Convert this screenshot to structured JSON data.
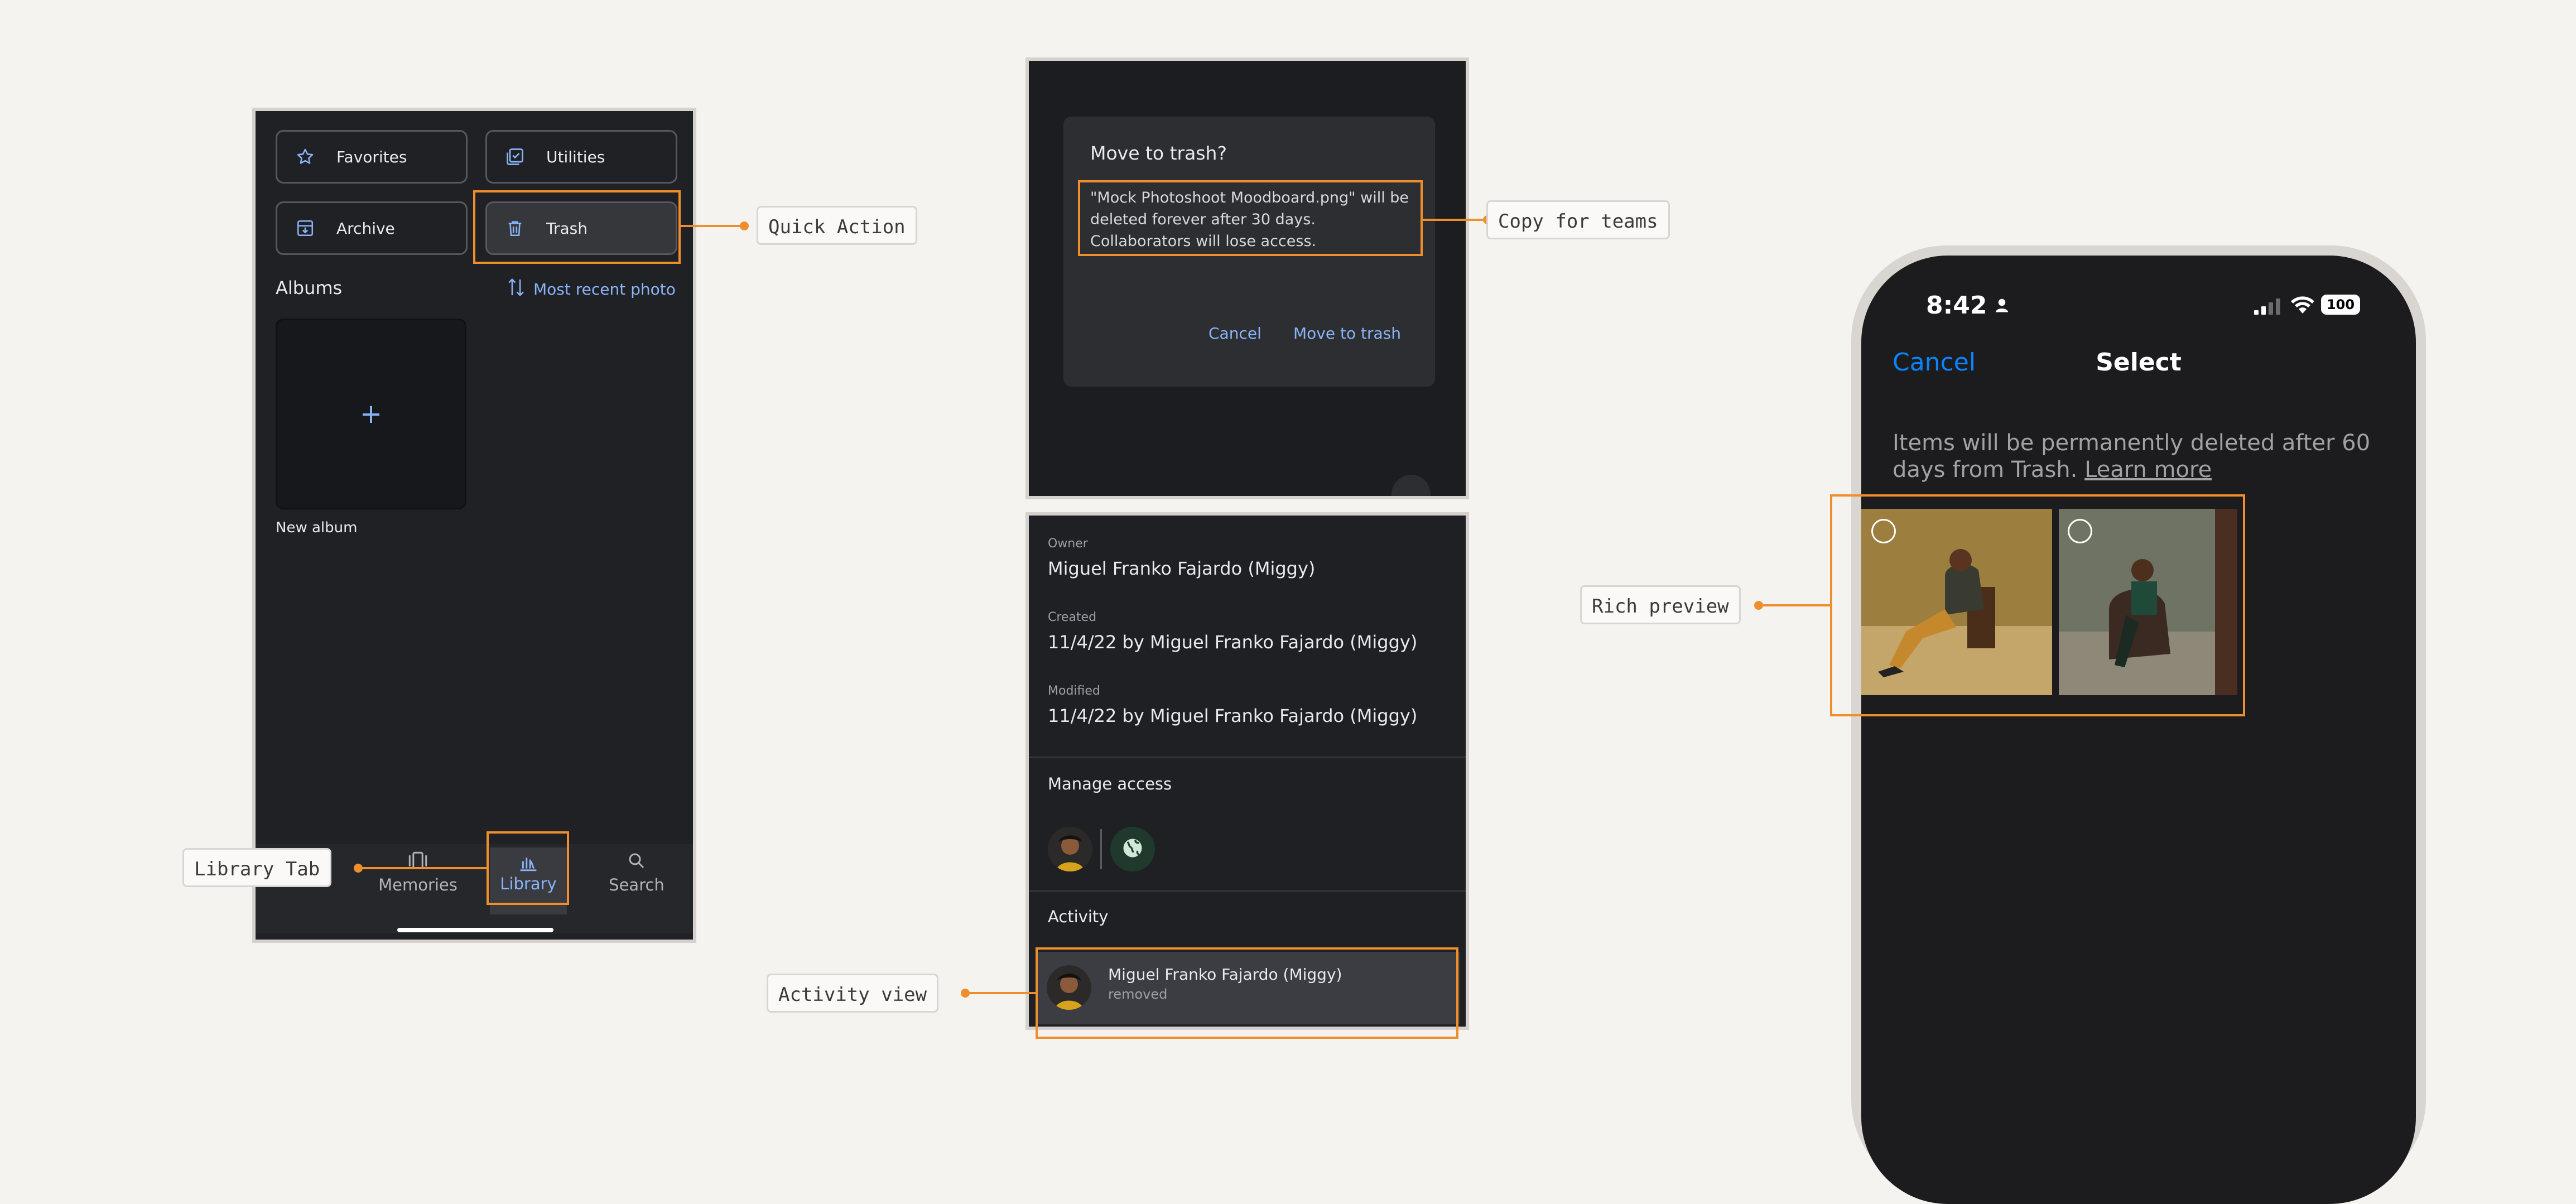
{
  "panel_library": {
    "quick_actions": [
      "Favorites",
      "Utilities",
      "Archive",
      "Trash"
    ],
    "albums_heading": "Albums",
    "sort_label": "Most recent photo",
    "new_album_label": "New album",
    "nav": {
      "memories": "Memories",
      "library": "Library",
      "search": "Search"
    }
  },
  "panel_trash_dialog": {
    "title": "Move to trash?",
    "body": "\"Mock Photoshoot Moodboard.png\" will be deleted forever after 30 days. Collaborators will lose access.",
    "cancel": "Cancel",
    "confirm": "Move to trash"
  },
  "panel_details": {
    "owner_label": "Owner",
    "owner_value": "Miguel Franko Fajardo (Miggy)",
    "created_label": "Created",
    "created_value": "11/4/22 by Miguel Franko Fajardo (Miggy)",
    "modified_label": "Modified",
    "modified_value": "11/4/22 by Miguel Franko Fajardo (Miggy)",
    "manage_access": "Manage access",
    "activity_heading": "Activity",
    "activity_name": "Miguel Franko Fajardo (Miggy)",
    "activity_action": "removed"
  },
  "phone": {
    "time": "8:42",
    "battery": "100",
    "cancel": "Cancel",
    "title": "Select",
    "notice": "Items will be permanently deleted after 60 days from Trash.",
    "learn_more": "Learn more"
  },
  "annotations": {
    "quick_action": "Quick Action",
    "copy_for_teams": "Copy for teams",
    "library_tab": "Library Tab",
    "activity_view": "Activity view",
    "rich_preview": "Rich preview"
  },
  "colors": {
    "accent_orange": "#ef8f2c",
    "link_blue": "#8ab4f8",
    "ios_blue": "#0a84ff",
    "panel_dark": "#202125",
    "background": "#f5f3ef"
  }
}
